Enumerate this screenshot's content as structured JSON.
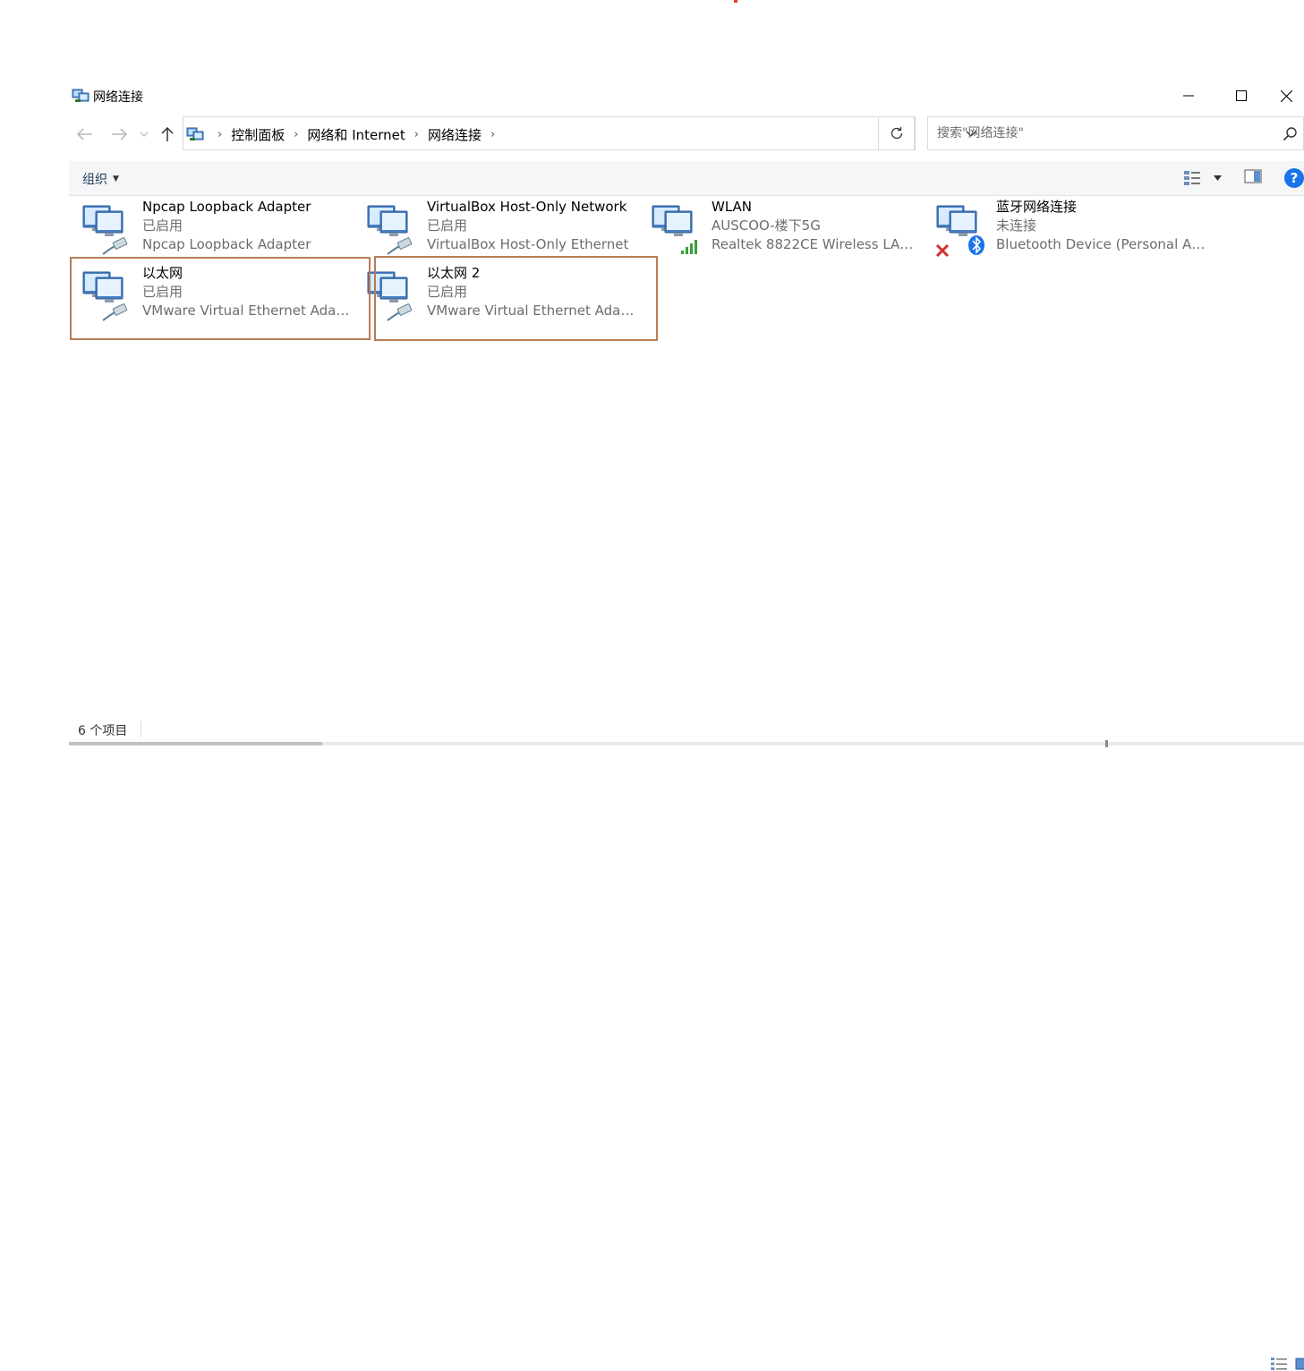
{
  "window": {
    "title": "网络连接",
    "controls": [
      "minimize-icon",
      "maximize-icon",
      "close-icon"
    ]
  },
  "navigation": {
    "breadcrumbs": [
      "控制面板",
      "网络和 Internet",
      "网络连接"
    ],
    "search_placeholder": "搜索\"网络连接\""
  },
  "command_bar": {
    "organize_label": "组织"
  },
  "connections": [
    {
      "name": "Npcap Loopback Adapter",
      "status": "已启用",
      "device": "Npcap Loopback Adapter",
      "icon": "wired-network-icon",
      "highlighted": false
    },
    {
      "name": "VirtualBox Host-Only Network",
      "status": "已启用",
      "device": "VirtualBox Host-Only Ethernet",
      "icon": "wired-network-icon",
      "highlighted": false
    },
    {
      "name": "WLAN",
      "status": "AUSCOO-楼下5G",
      "device": "Realtek 8822CE Wireless LAN ...",
      "icon": "wireless-network-icon",
      "highlighted": false
    },
    {
      "name": "蓝牙网络连接",
      "status": "未连接",
      "device": "Bluetooth Device (Personal Ar...",
      "icon": "bluetooth-network-icon",
      "highlighted": false
    },
    {
      "name": "以太网",
      "status": "已启用",
      "device": "VMware Virtual Ethernet Adap...",
      "icon": "wired-network-icon",
      "highlighted": true
    },
    {
      "name": "以太网 2",
      "status": "已启用",
      "device": "VMware Virtual Ethernet Adap...",
      "icon": "wired-network-icon",
      "highlighted": true
    }
  ],
  "status_bar": {
    "item_count": "6 个项目"
  },
  "colors": {
    "highlight_border": "#b87c55",
    "secondary_text": "#6d6d6d",
    "command_bar_bg": "#f5f6f7",
    "help_blue": "#1a73e8",
    "signal_green": "#3a9d3a"
  }
}
